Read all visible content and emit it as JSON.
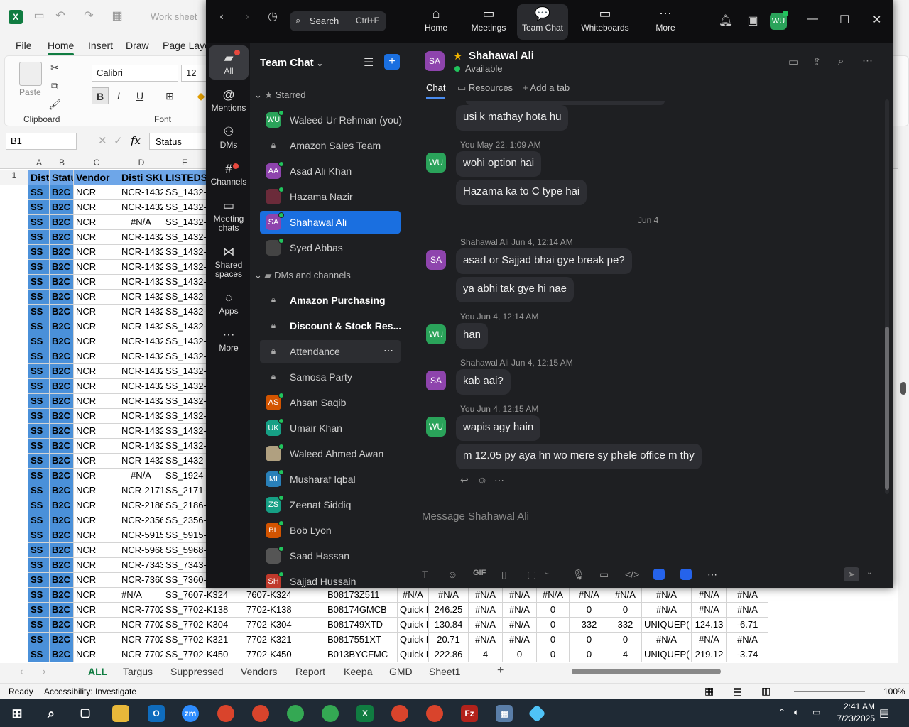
{
  "excel": {
    "title_doc": "Work sheet",
    "menu": [
      "File",
      "Home",
      "Insert",
      "Draw",
      "Page Layo"
    ],
    "active_menu": "Home",
    "clipboard_label": "Clipboard",
    "paste_label": "Paste",
    "font_group_label": "Font",
    "font_name": "Calibri",
    "font_size": "12",
    "name_box": "B1",
    "formula_value": "Status",
    "columns": [
      "A",
      "B",
      "C",
      "D",
      "E"
    ],
    "header_row": [
      "Dist",
      "Statu",
      "Vendor",
      "Disti SKU",
      "LISTEDSI"
    ],
    "rows": [
      [
        "SS",
        "B2C",
        "NCR",
        "NCR-1432",
        "SS_1432-("
      ],
      [
        "SS",
        "B2C",
        "NCR",
        "NCR-1432",
        "SS_1432-("
      ],
      [
        "SS",
        "B2C",
        "NCR",
        "#N/A",
        "SS_1432-("
      ],
      [
        "SS",
        "B2C",
        "NCR",
        "NCR-1432",
        "SS_1432-("
      ],
      [
        "SS",
        "B2C",
        "NCR",
        "NCR-1432",
        "SS_1432-("
      ],
      [
        "SS",
        "B2C",
        "NCR",
        "NCR-1432",
        "SS_1432-("
      ],
      [
        "SS",
        "B2C",
        "NCR",
        "NCR-1432",
        "SS_1432-("
      ],
      [
        "SS",
        "B2C",
        "NCR",
        "NCR-1432",
        "SS_1432-("
      ],
      [
        "SS",
        "B2C",
        "NCR",
        "NCR-1432",
        "SS_1432-("
      ],
      [
        "SS",
        "B2C",
        "NCR",
        "NCR-1432",
        "SS_1432-("
      ],
      [
        "SS",
        "B2C",
        "NCR",
        "NCR-1432",
        "SS_1432-("
      ],
      [
        "SS",
        "B2C",
        "NCR",
        "NCR-1432",
        "SS_1432-("
      ],
      [
        "SS",
        "B2C",
        "NCR",
        "NCR-1432",
        "SS_1432-("
      ],
      [
        "SS",
        "B2C",
        "NCR",
        "NCR-1432",
        "SS_1432-("
      ],
      [
        "SS",
        "B2C",
        "NCR",
        "NCR-1432",
        "SS_1432-("
      ],
      [
        "SS",
        "B2C",
        "NCR",
        "NCR-1432",
        "SS_1432-("
      ],
      [
        "SS",
        "B2C",
        "NCR",
        "NCR-1432",
        "SS_1432-("
      ],
      [
        "SS",
        "B2C",
        "NCR",
        "NCR-1432",
        "SS_1432-("
      ],
      [
        "SS",
        "B2C",
        "NCR",
        "NCR-1432",
        "SS_1432-("
      ],
      [
        "SS",
        "B2C",
        "NCR",
        "#N/A",
        "SS_1924-("
      ],
      [
        "SS",
        "B2C",
        "NCR",
        "NCR-2171",
        "SS_2171-("
      ],
      [
        "SS",
        "B2C",
        "NCR",
        "NCR-2186",
        "SS_2186-("
      ],
      [
        "SS",
        "B2C",
        "NCR",
        "NCR-2356",
        "SS_2356-("
      ],
      [
        "SS",
        "B2C",
        "NCR",
        "NCR-5915",
        "SS_5915-("
      ],
      [
        "SS",
        "B2C",
        "NCR",
        "NCR-5968",
        "SS_5968-("
      ],
      [
        "SS",
        "B2C",
        "NCR",
        "NCR-7343",
        "SS_7343-("
      ],
      [
        "SS",
        "B2C",
        "NCR",
        "NCR-7360",
        "SS_7360-("
      ]
    ],
    "visible_bottom_rows": [
      [
        "SS",
        "B2C",
        "NCR",
        "#N/A",
        "SS_7607-K324",
        "7607-K324",
        "B08173Z511",
        "#N/A",
        "#N/A",
        "#N/A",
        "#N/A",
        "#N/A",
        "#N/A",
        "#N/A",
        "#N/A",
        "#N/A",
        "#N/A"
      ],
      [
        "SS",
        "B2C",
        "NCR",
        "NCR-7702",
        "SS_7702-K138",
        "7702-K138",
        "B08174GMCB",
        "Quick F",
        "246.25",
        "#N/A",
        "#N/A",
        "0",
        "0",
        "0",
        "#N/A",
        "#N/A",
        "#N/A"
      ],
      [
        "SS",
        "B2C",
        "NCR",
        "NCR-7702",
        "SS_7702-K304",
        "7702-K304",
        "B081749XTD",
        "Quick F",
        "130.84",
        "#N/A",
        "#N/A",
        "0",
        "332",
        "332",
        "UNIQUEP(",
        "124.13",
        "-6.71"
      ],
      [
        "SS",
        "B2C",
        "NCR",
        "NCR-7702",
        "SS_7702-K321",
        "7702-K321",
        "B0817551XT",
        "Quick F",
        "20.71",
        "#N/A",
        "#N/A",
        "0",
        "0",
        "0",
        "#N/A",
        "#N/A",
        "#N/A"
      ],
      [
        "SS",
        "B2C",
        "NCR",
        "NCR-7702",
        "SS_7702-K450",
        "7702-K450",
        "B013BYCFMC",
        "Quick F",
        "222.86",
        "4",
        "0",
        "0",
        "0",
        "4",
        "UNIQUEP(",
        "219.12",
        "-3.74"
      ]
    ],
    "row_number_first": "1",
    "sheets": [
      "ALL",
      "Targus",
      "Suppressed",
      "Vendors",
      "Report",
      "Keepa",
      "GMD",
      "Sheet1"
    ],
    "active_sheet": "ALL",
    "status_ready": "Ready",
    "status_accessibility": "Accessibility: Investigate",
    "zoom": "100%"
  },
  "zoom_app": {
    "search_label": "Search",
    "search_shortcut": "Ctrl+F",
    "nav": [
      {
        "label": "Home",
        "icon": "home-icon"
      },
      {
        "label": "Meetings",
        "icon": "video-icon"
      },
      {
        "label": "Team Chat",
        "icon": "chat-icon"
      },
      {
        "label": "Whiteboards",
        "icon": "whiteboard-icon"
      },
      {
        "label": "More",
        "icon": "more-icon"
      }
    ],
    "active_nav": "Team Chat",
    "user_initials": "WU",
    "rail": [
      {
        "label": "All",
        "icon": "chat-bubble-icon"
      },
      {
        "label": "Mentions",
        "icon": "at-icon"
      },
      {
        "label": "DMs",
        "icon": "people-icon"
      },
      {
        "label": "Channels",
        "icon": "hash-icon"
      },
      {
        "label": "Meeting chats",
        "icon": "calendar-icon"
      },
      {
        "label": "Shared spaces",
        "icon": "share-icon"
      },
      {
        "label": "Apps",
        "icon": "apps-icon"
      },
      {
        "label": "More",
        "icon": "ellipsis-icon"
      }
    ],
    "list_title": "Team Chat",
    "sections": {
      "starred": "Starred",
      "dms": "DMs and channels"
    },
    "starred": [
      {
        "name": "Waleed Ur Rehman (you)",
        "initials": "WU",
        "color": "#2aa35a",
        "presence": true
      },
      {
        "name": "Amazon Sales Team",
        "lock": true
      },
      {
        "name": "Asad Ali Khan",
        "initials": "AA",
        "color": "#8e44ad",
        "presence": true
      },
      {
        "name": "Hazama Nazir",
        "initials": "",
        "color": "#6b2b3a",
        "presence": true
      },
      {
        "name": "Shahawal Ali",
        "initials": "SA",
        "color": "#8e44ad",
        "presence": true,
        "selected": true
      },
      {
        "name": "Syed Abbas",
        "initials": "",
        "color": "#444",
        "presence": true
      }
    ],
    "channels": [
      {
        "name": "Amazon Purchasing",
        "lock": true,
        "bold": true
      },
      {
        "name": "Discount & Stock Res...",
        "lock": true,
        "bold": true
      },
      {
        "name": "Attendance",
        "lock": true,
        "hover": true
      },
      {
        "name": "Samosa Party",
        "lock": true
      },
      {
        "name": "Ahsan Saqib",
        "initials": "AS",
        "color": "#d35400",
        "presence": true
      },
      {
        "name": "Umair Khan",
        "initials": "UK",
        "color": "#16a085",
        "presence": true
      },
      {
        "name": "Waleed Ahmed Awan",
        "initials": "",
        "color": "#b0a080",
        "presence": true
      },
      {
        "name": "Musharaf Iqbal",
        "initials": "MI",
        "color": "#2980b9",
        "presence": true
      },
      {
        "name": "Zeenat Siddiq",
        "initials": "ZS",
        "color": "#16a085",
        "presence": true
      },
      {
        "name": "Bob Lyon",
        "initials": "BL",
        "color": "#d35400",
        "presence": true
      },
      {
        "name": "Saad Hassan",
        "initials": "",
        "color": "#555",
        "presence": true
      },
      {
        "name": "Sajjad Hussain",
        "initials": "SH",
        "color": "#c0392b",
        "presence": true
      }
    ],
    "chat": {
      "contact_name": "Shahawal Ali",
      "contact_initials": "SA",
      "status": "Available",
      "tabs": [
        "Chat",
        "Resources",
        "Add a tab"
      ],
      "composer_placeholder": "Message Shahawal Ali",
      "gif_label": "GIF",
      "messages": [
        {
          "meta": "",
          "text": "usi k mathay hota hu"
        },
        {
          "meta": "You May 22, 1:09 AM",
          "text": "wohi option hai",
          "avatar": "WU"
        },
        {
          "meta": "",
          "text": "Hazama ka to C type hai"
        },
        {
          "date_divider": "Jun 4"
        },
        {
          "meta": "Shahawal Ali Jun 4, 12:14 AM",
          "text": "asad or Sajjad bhai gye break pe?",
          "avatar": "SA"
        },
        {
          "meta": "",
          "text": "ya abhi tak gye hi nae"
        },
        {
          "meta": "You Jun 4, 12:14 AM",
          "text": "han",
          "avatar": "WU"
        },
        {
          "meta": "Shahawal Ali Jun 4, 12:15 AM",
          "text": "kab aai?",
          "avatar": "SA"
        },
        {
          "meta": "You Jun 4, 12:15 AM",
          "text": "wapis agy hain",
          "avatar": "WU"
        },
        {
          "meta": "",
          "text": "m 12.05 py aya hn wo mere sy phele office m thy"
        }
      ]
    }
  },
  "taskbar": {
    "time": "2:41 AM",
    "date": "7/23/2025"
  }
}
